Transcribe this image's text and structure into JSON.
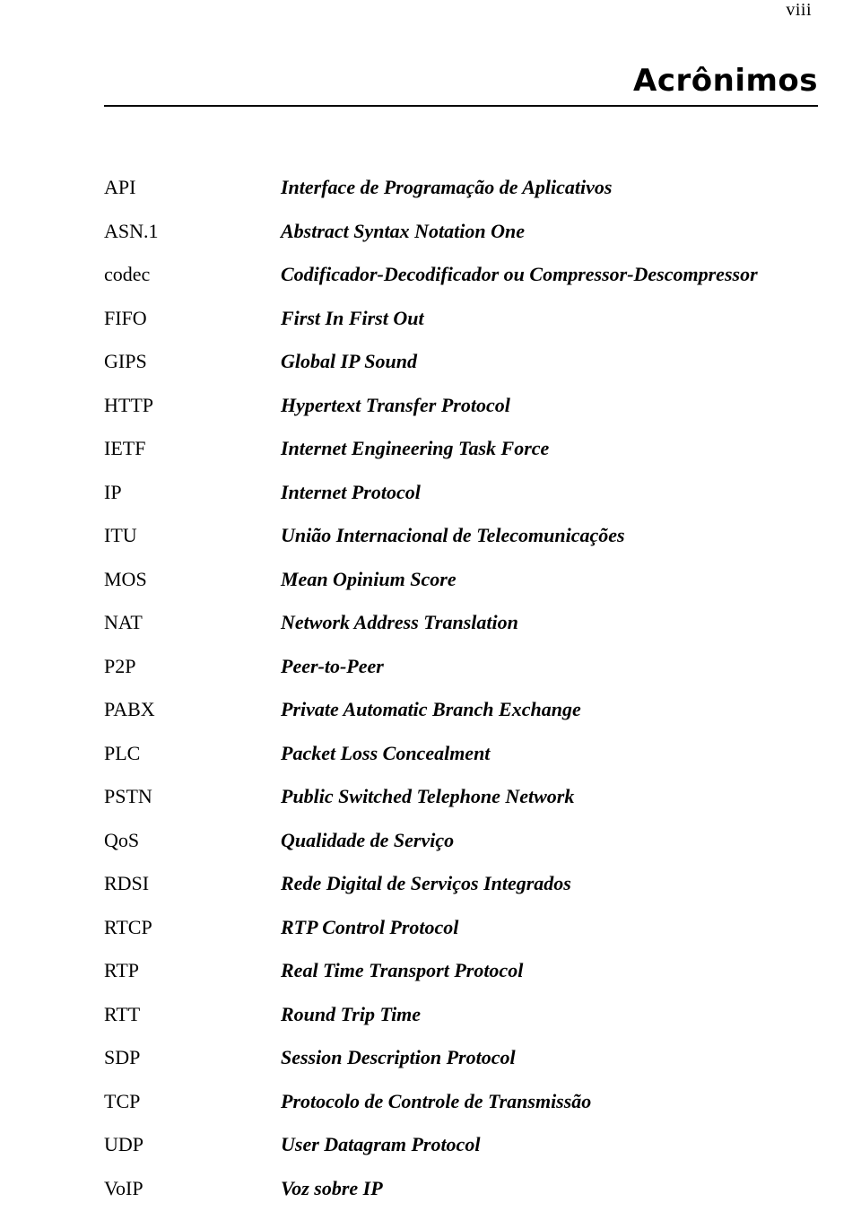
{
  "page": {
    "number": "viii",
    "title": "Acrônimos"
  },
  "acronyms": [
    {
      "term": "API",
      "definition": "Interface de Programação de Aplicativos"
    },
    {
      "term": "ASN.1",
      "definition": "Abstract Syntax Notation One"
    },
    {
      "term": "codec",
      "definition": "Codificador-Decodificador ou Compressor-Descompressor"
    },
    {
      "term": "FIFO",
      "definition": "First In First Out"
    },
    {
      "term": "GIPS",
      "definition": "Global IP Sound"
    },
    {
      "term": "HTTP",
      "definition": "Hypertext Transfer Protocol"
    },
    {
      "term": "IETF",
      "definition": "Internet Engineering Task Force"
    },
    {
      "term": "IP",
      "definition": "Internet Protocol"
    },
    {
      "term": "ITU",
      "definition": "União Internacional de Telecomunicações"
    },
    {
      "term": "MOS",
      "definition": "Mean Opinium Score"
    },
    {
      "term": "NAT",
      "definition": "Network Address Translation"
    },
    {
      "term": "P2P",
      "definition": "Peer-to-Peer"
    },
    {
      "term": "PABX",
      "definition": "Private Automatic Branch Exchange"
    },
    {
      "term": "PLC",
      "definition": "Packet Loss Concealment"
    },
    {
      "term": "PSTN",
      "definition": "Public Switched Telephone Network"
    },
    {
      "term": "QoS",
      "definition": "Qualidade de Serviço"
    },
    {
      "term": "RDSI",
      "definition": "Rede Digital de Serviços Integrados"
    },
    {
      "term": "RTCP",
      "definition": "RTP Control Protocol"
    },
    {
      "term": "RTP",
      "definition": "Real Time Transport Protocol"
    },
    {
      "term": "RTT",
      "definition": "Round Trip Time"
    },
    {
      "term": "SDP",
      "definition": "Session Description Protocol"
    },
    {
      "term": "TCP",
      "definition": "Protocolo de Controle de Transmissão"
    },
    {
      "term": "UDP",
      "definition": "User Datagram Protocol"
    },
    {
      "term": "VoIP",
      "definition": "Voz sobre IP"
    }
  ]
}
